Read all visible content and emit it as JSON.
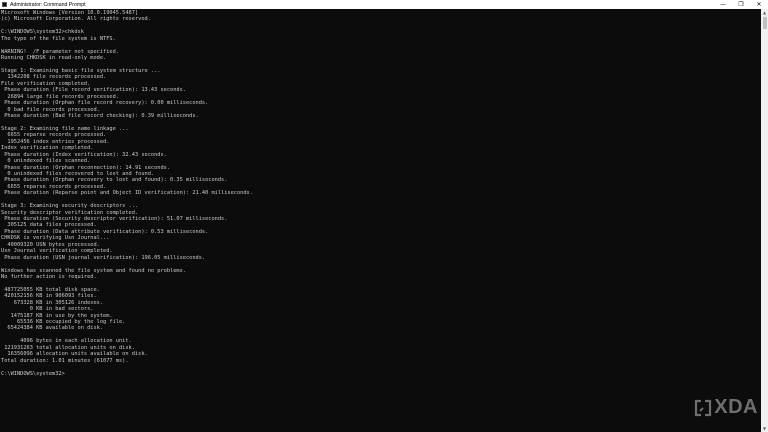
{
  "window": {
    "title": "Administrator: Command Prompt",
    "controls": {
      "minimize": "—",
      "maximize": "❐",
      "close": "✕"
    }
  },
  "console": {
    "lines": [
      "Microsoft Windows [Version 10.0.19045.5487]",
      "(c) Microsoft Corporation. All rights reserved.",
      "",
      "C:\\WINDOWS\\system32>chkdsk",
      "The type of the file system is NTFS.",
      "",
      "WARNING!  /F parameter not specified.",
      "Running CHKDSK in read-only mode.",
      "",
      "Stage 1: Examining basic file system structure ...",
      "  1342208 file records processed.",
      "File verification completed.",
      " Phase duration (File record verification): 13.43 seconds.",
      "  26894 large file records processed.",
      " Phase duration (Orphan file record recovery): 0.00 milliseconds.",
      "  0 bad file records processed.",
      " Phase duration (Bad file record checking): 0.39 milliseconds.",
      "",
      "Stage 2: Examining file name linkage ...",
      "  6655 reparse records processed.",
      "  1952456 index entries processed.",
      "Index verification completed.",
      " Phase duration (Index verification): 32.43 seconds.",
      "  0 unindexed files scanned.",
      " Phase duration (Orphan reconnection): 14.91 seconds.",
      "  0 unindexed files recovered to lost and found.",
      " Phase duration (Orphan recovery to lost and found): 0.35 milliseconds.",
      "  6655 reparse records processed.",
      " Phase duration (Reparse point and Object ID verification): 21.40 milliseconds.",
      "",
      "Stage 3: Examining security descriptors ...",
      "Security descriptor verification completed.",
      " Phase duration (Security descriptor verification): 51.07 milliseconds.",
      "  305125 data files processed.",
      " Phase duration (Data attribute verification): 0.53 milliseconds.",
      "CHKDSK is verifying Usn Journal...",
      "  40009320 USN bytes processed.",
      "Usn Journal verification completed.",
      " Phase duration (USN journal verification): 196.05 milliseconds.",
      "",
      "Windows has scanned the file system and found no problems.",
      "No further action is required.",
      "",
      " 487725055 KB total disk space.",
      " 420152156 KB in 906093 files.",
      "    673328 KB in 305126 indexes.",
      "         0 KB in bad sectors.",
      "   1475187 KB in use by the system.",
      "     65536 KB occupied by the log file.",
      "  65424384 KB available on disk.",
      "",
      "      4096 bytes in each allocation unit.",
      " 121931263 total allocation units on disk.",
      "  16356096 allocation units available on disk.",
      "Total duration: 1.01 minutes (61077 ms).",
      "",
      "C:\\WINDOWS\\system32>"
    ]
  },
  "scrollbar": {
    "up_arrow": "▲",
    "down_arrow": "▼"
  },
  "watermark": {
    "brand": "XDA",
    "color": "#bfbfbf"
  },
  "colors": {
    "console_bg": "#0c0c0c",
    "console_fg": "#cccccc",
    "titlebar_bg": "#ffffff"
  }
}
